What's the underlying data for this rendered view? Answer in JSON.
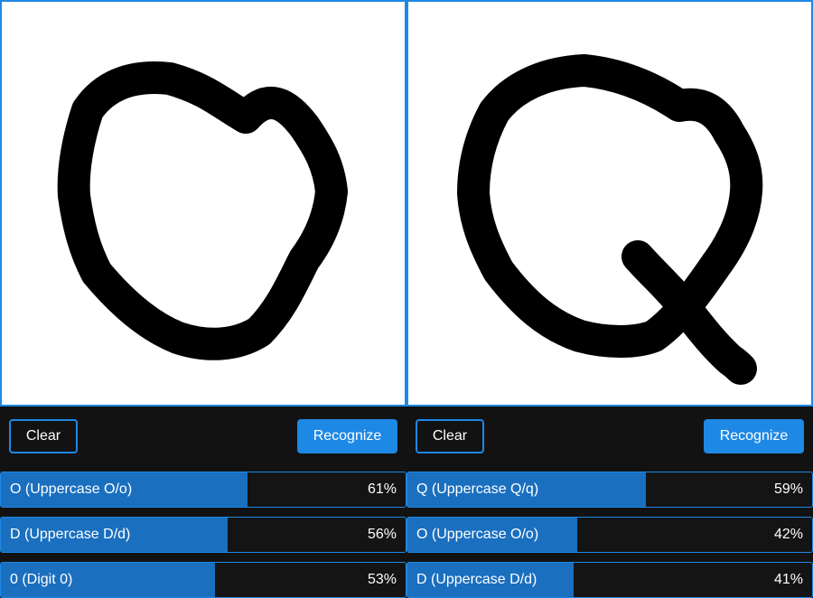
{
  "panels": [
    {
      "clear_label": "Clear",
      "recognize_label": "Recognize",
      "results": [
        {
          "label": "O (Uppercase O/o)",
          "percent_text": "61%",
          "confidence": 0.61
        },
        {
          "label": "D (Uppercase D/d)",
          "percent_text": "56%",
          "confidence": 0.56
        },
        {
          "label": "0 (Digit 0)",
          "percent_text": "53%",
          "confidence": 0.53
        }
      ]
    },
    {
      "clear_label": "Clear",
      "recognize_label": "Recognize",
      "results": [
        {
          "label": "Q (Uppercase Q/q)",
          "percent_text": "59%",
          "confidence": 0.59
        },
        {
          "label": "O (Uppercase O/o)",
          "percent_text": "42%",
          "confidence": 0.42
        },
        {
          "label": "D (Uppercase D/d)",
          "percent_text": "41%",
          "confidence": 0.41
        }
      ]
    }
  ],
  "colors": {
    "accent": "#1e88e5",
    "bar_fill": "#1a6fbf",
    "background": "#121212",
    "ink": "#000000",
    "canvas": "#ffffff"
  }
}
